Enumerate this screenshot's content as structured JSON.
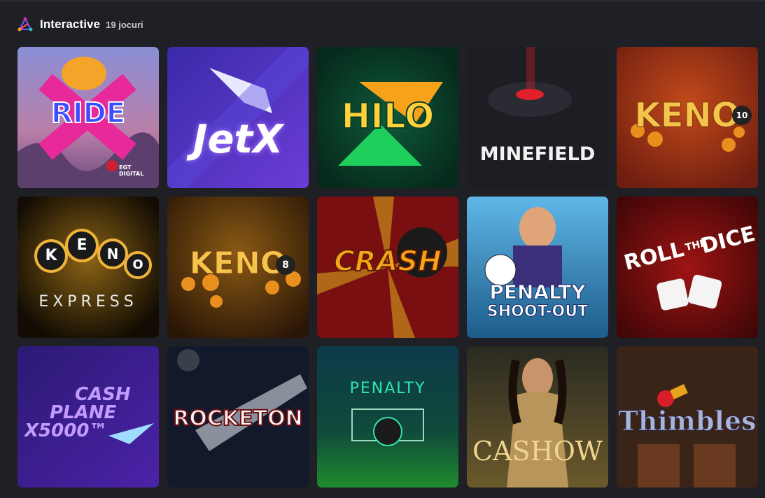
{
  "section": {
    "title": "Interactive",
    "count": "19 jocuri",
    "icon": "prism-icon"
  },
  "games": [
    {
      "id": "ride",
      "title": "RIDE",
      "badge": "EGT DIGITAL"
    },
    {
      "id": "jetx",
      "title": "JetX"
    },
    {
      "id": "hilo",
      "title": "HILO"
    },
    {
      "id": "minefield",
      "title": "MINEFIELD"
    },
    {
      "id": "keno10",
      "title": "KENO",
      "number": "10"
    },
    {
      "id": "keno-express",
      "letters": [
        "K",
        "E",
        "N",
        "O"
      ],
      "subtitle": "EXPRESS"
    },
    {
      "id": "keno8",
      "title": "KENO",
      "number": "8"
    },
    {
      "id": "crash",
      "title": "CRASH"
    },
    {
      "id": "penalty-shootout",
      "title": "PENALTY",
      "subtitle": "SHOOT-OUT"
    },
    {
      "id": "roll-the-dice",
      "line1": "ROLL",
      "line2": "THE",
      "line3": "DICE"
    },
    {
      "id": "cash-plane",
      "line1": "CASH",
      "line2": "PLANE",
      "line3": "X5000™"
    },
    {
      "id": "rocketon",
      "title": "ROCKETON"
    },
    {
      "id": "penalty",
      "title": "PENALTY"
    },
    {
      "id": "cashow",
      "title": "CASHOW"
    },
    {
      "id": "thimbles",
      "title": "Thimbles"
    }
  ],
  "colors": {
    "background": "#1f1f26",
    "accent_orange": "#f7a21b",
    "accent_pink": "#e8299a"
  }
}
